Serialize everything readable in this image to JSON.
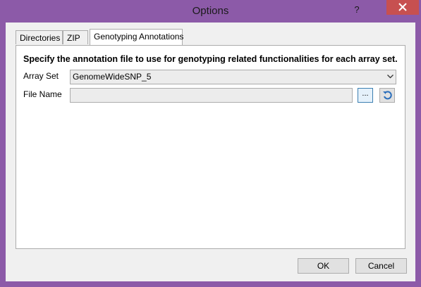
{
  "window": {
    "title": "Options",
    "help_label": "?",
    "accent": "#8c5aa8",
    "close_color": "#c75050"
  },
  "tabs": [
    {
      "label": "Directories"
    },
    {
      "label": "ZIP"
    },
    {
      "label": "Genotyping Annotations"
    }
  ],
  "panel": {
    "heading": "Specify the annotation file to use for genotyping related functionalities for each array set.",
    "array_set_label": "Array Set",
    "array_set_value": "GenomeWideSNP_5",
    "file_name_label": "File Name",
    "file_name_value": "",
    "browse_label": "..."
  },
  "footer": {
    "ok_label": "OK",
    "cancel_label": "Cancel"
  }
}
